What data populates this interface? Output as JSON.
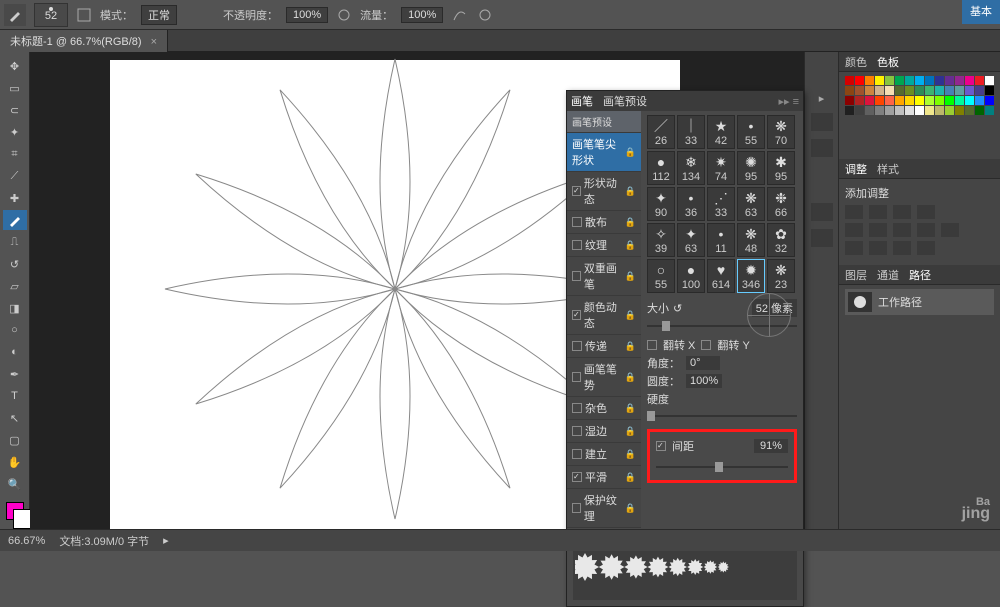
{
  "optbar": {
    "brush_size": "52",
    "mode_label": "模式：",
    "mode_value": "正常",
    "opacity_label": "不透明度：",
    "opacity_value": "100%",
    "flow_label": "流量：",
    "flow_value": "100%"
  },
  "topright_label": "基本",
  "document_tab": {
    "title": "未标题-1 @ 66.7%(RGB/8)",
    "close": "×"
  },
  "status": {
    "zoom": "66.67%",
    "doc_info": "文档:3.09M/0 字节"
  },
  "right_tabs": {
    "color": "颜色",
    "swatches": "色板",
    "adjust": "调整",
    "styles": "样式",
    "adjust_title": "添加调整",
    "layers": "图层",
    "channels": "通道",
    "paths": "路径",
    "path_name": "工作路径"
  },
  "swatch_colors": [
    "#d40000",
    "#ff0000",
    "#ff7f00",
    "#fff200",
    "#89c540",
    "#00a651",
    "#00a99d",
    "#00aeef",
    "#0072bc",
    "#2e3192",
    "#662d91",
    "#92278f",
    "#ec008c",
    "#ed1c24",
    "#ffffff",
    "#8b4513",
    "#a0522d",
    "#cd853f",
    "#d2b48c",
    "#f5deb3",
    "#556b2f",
    "#6b8e23",
    "#2e8b57",
    "#3cb371",
    "#20b2aa",
    "#4682b4",
    "#5f9ea0",
    "#6a5acd",
    "#483d8b",
    "#000000",
    "#8b0000",
    "#b22222",
    "#dc143c",
    "#ff4500",
    "#ff6347",
    "#ffa500",
    "#ffd700",
    "#ffff00",
    "#adff2f",
    "#7fff00",
    "#00ff00",
    "#00fa9a",
    "#00ffff",
    "#1e90ff",
    "#0000ff",
    "#202020",
    "#404040",
    "#606060",
    "#808080",
    "#a0a0a0",
    "#c0c0c0",
    "#e0e0e0",
    "#ffffff",
    "#f0e68c",
    "#bdb76b",
    "#9acd32",
    "#808000",
    "#556b2f",
    "#006400",
    "#008080"
  ],
  "brush_panel": {
    "tab_brush": "画笔",
    "tab_presets": "画笔预设",
    "presets_btn": "画笔预设",
    "items": [
      {
        "label": "画笔笔尖形状",
        "checked": null,
        "selected": true
      },
      {
        "label": "形状动态",
        "checked": true
      },
      {
        "label": "散布",
        "checked": false
      },
      {
        "label": "纹理",
        "checked": false
      },
      {
        "label": "双重画笔",
        "checked": false
      },
      {
        "label": "颜色动态",
        "checked": true
      },
      {
        "label": "传递",
        "checked": false
      },
      {
        "label": "画笔笔势",
        "checked": false
      },
      {
        "label": "杂色",
        "checked": false
      },
      {
        "label": "湿边",
        "checked": false
      },
      {
        "label": "建立",
        "checked": false
      },
      {
        "label": "平滑",
        "checked": true
      },
      {
        "label": "保护纹理",
        "checked": false
      }
    ],
    "tips": [
      "26",
      "33",
      "42",
      "55",
      "70",
      "112",
      "134",
      "74",
      "95",
      "95",
      "90",
      "36",
      "33",
      "63",
      "66",
      "39",
      "63",
      "11",
      "48",
      "32",
      "55",
      "100",
      "614",
      "346",
      "23"
    ],
    "selected_tip_index": 23,
    "size_label": "大小",
    "size_value": "52 像素",
    "flipx": "翻转 X",
    "flipy": "翻转 Y",
    "angle_label": "角度：",
    "angle_value": "0°",
    "round_label": "圆度：",
    "round_value": "100%",
    "hard_label": "硬度",
    "spacing_label": "间距",
    "spacing_value": "91%"
  },
  "watermark": {
    "big": "Ba",
    "small": "jing"
  }
}
